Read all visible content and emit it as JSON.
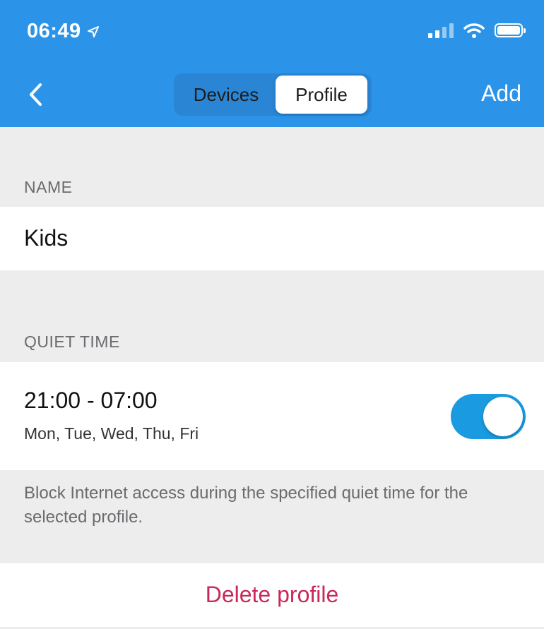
{
  "status_bar": {
    "time": "06:49"
  },
  "nav": {
    "back_icon": "chevron-left-icon",
    "tabs": [
      {
        "label": "Devices",
        "selected": false
      },
      {
        "label": "Profile",
        "selected": true
      }
    ],
    "add_label": "Add"
  },
  "name_section": {
    "label": "NAME",
    "value": "Kids"
  },
  "quiet_time": {
    "label": "QUIET TIME",
    "time_range": "21:00 - 07:00",
    "days": "Mon, Tue, Wed, Thu, Fri",
    "enabled": true,
    "description": "Block Internet access during the specified quiet time for the selected profile."
  },
  "delete_label": "Delete profile",
  "colors": {
    "header": "#2c94e8",
    "toggle_on": "#1a9ae0",
    "destructive": "#c9285a"
  }
}
